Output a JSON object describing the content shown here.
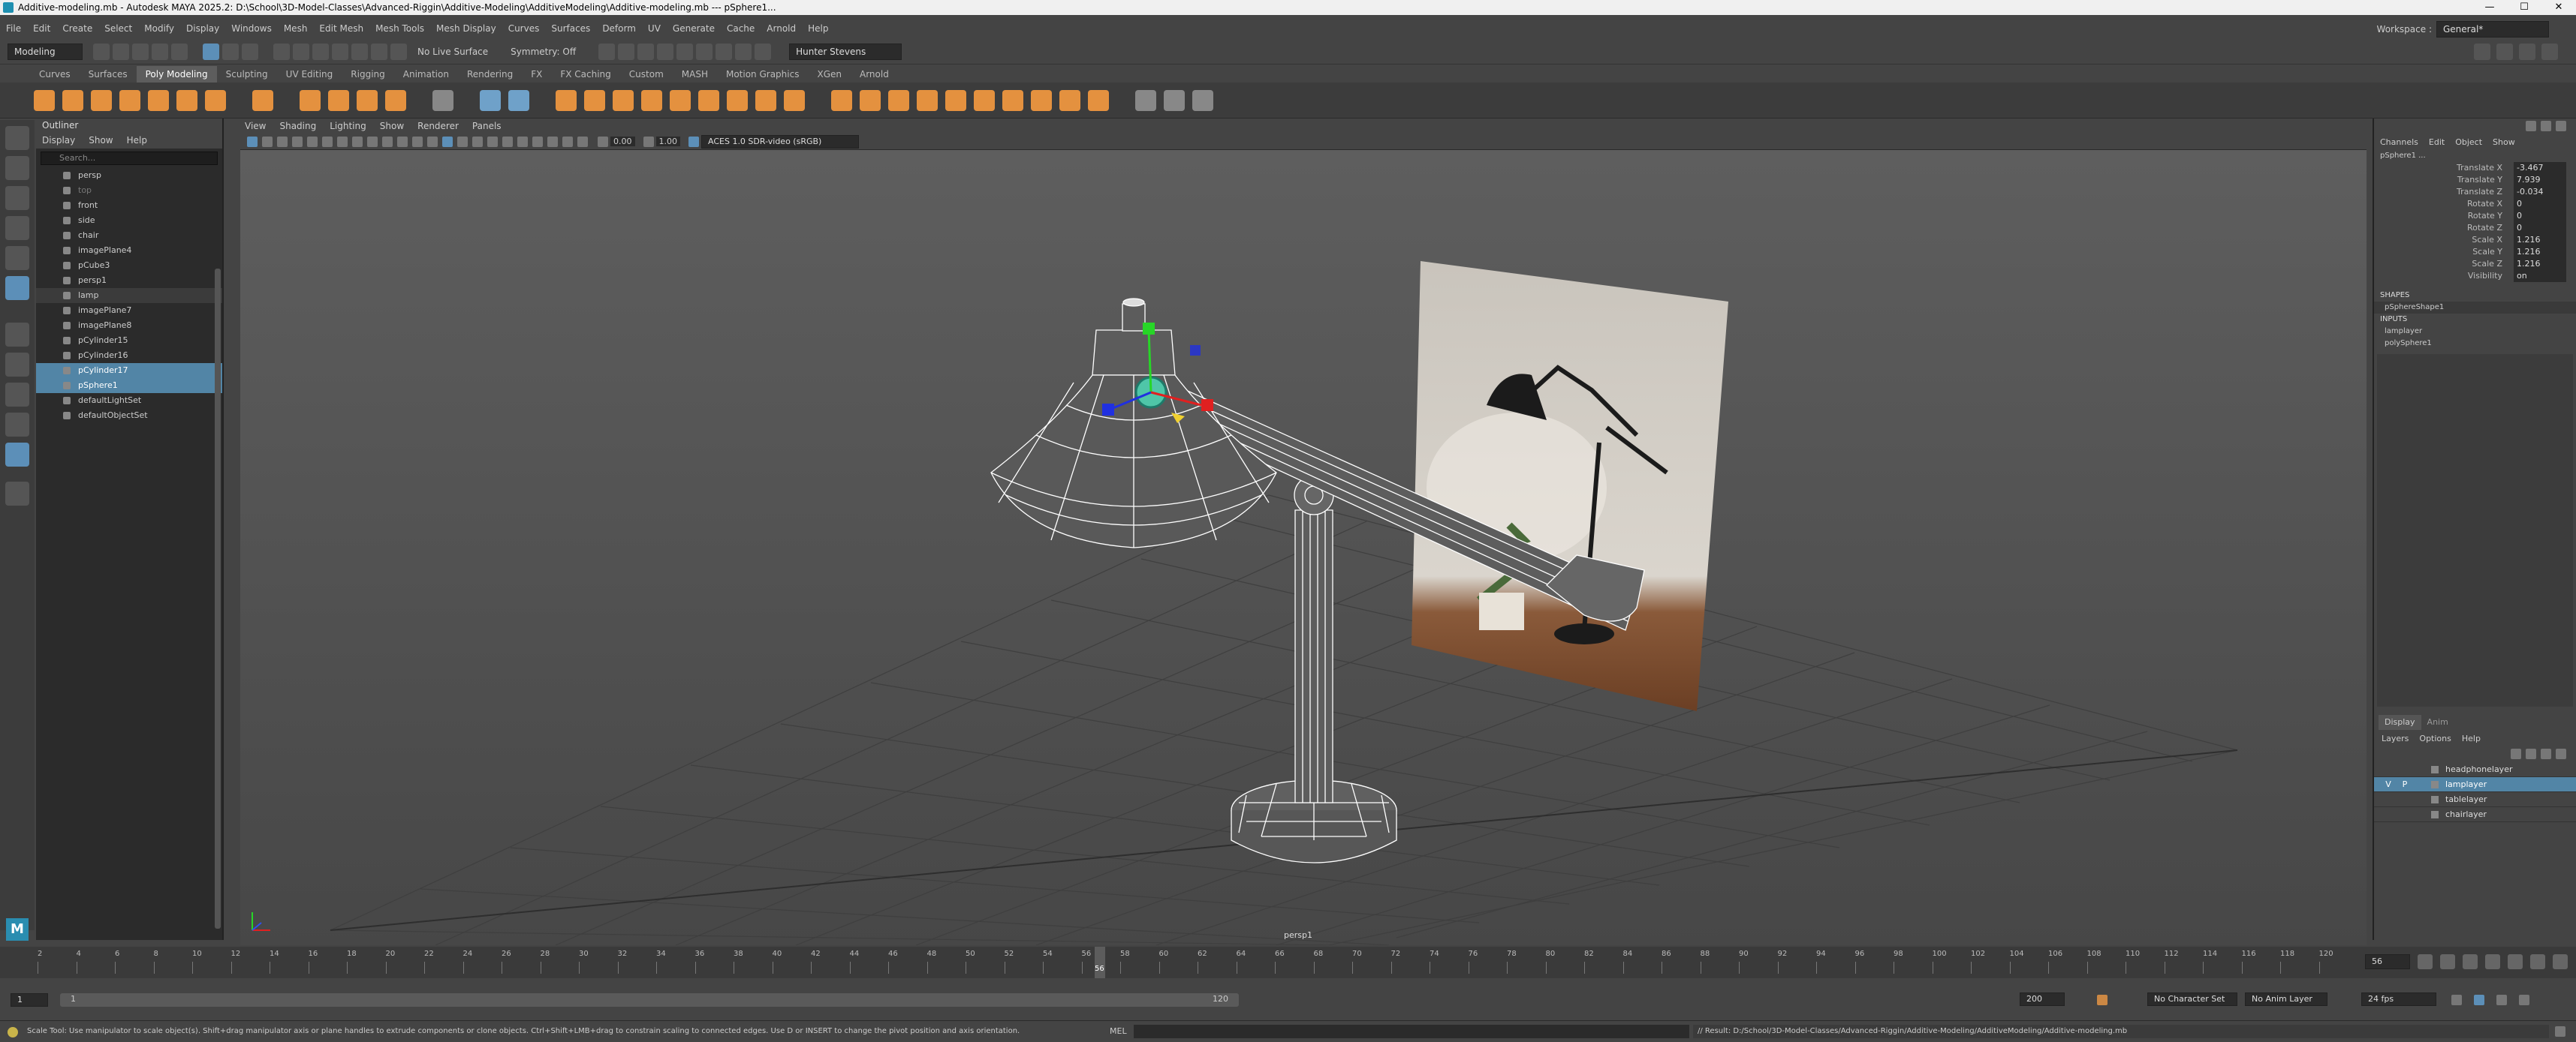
{
  "window": {
    "title": "Additive-modeling.mb - Autodesk MAYA 2025.2: D:\\School\\3D-Model-Classes\\Advanced-Riggin\\Additive-Modeling\\AdditiveModeling\\Additive-modeling.mb  ---  pSphere1...",
    "minimize": "—",
    "maximize": "☐",
    "close": "✕"
  },
  "menubar": {
    "items": [
      "File",
      "Edit",
      "Create",
      "Select",
      "Modify",
      "Display",
      "Windows",
      "Mesh",
      "Edit Mesh",
      "Mesh Tools",
      "Mesh Display",
      "Curves",
      "Surfaces",
      "Deform",
      "UV",
      "Generate",
      "Cache",
      "Arnold",
      "Help"
    ],
    "workspace_label": "Workspace :",
    "workspace_value": "General*"
  },
  "statusline": {
    "mode": "Modeling",
    "live_surface": "No Live Surface",
    "symmetry": "Symmetry: Off",
    "user": "Hunter Stevens"
  },
  "shelf_tabs": [
    "Curves",
    "Surfaces",
    "Poly Modeling",
    "Sculpting",
    "UV Editing",
    "Rigging",
    "Animation",
    "Rendering",
    "FX",
    "FX Caching",
    "Custom",
    "MASH",
    "Motion Graphics",
    "XGen",
    "Arnold"
  ],
  "shelf_active": "Poly Modeling",
  "outliner": {
    "title": "Outliner",
    "menus": [
      "Display",
      "Show",
      "Help"
    ],
    "search_placeholder": "Search...",
    "items": [
      {
        "label": "persp",
        "state": "normal"
      },
      {
        "label": "top",
        "state": "dim"
      },
      {
        "label": "front",
        "state": "normal"
      },
      {
        "label": "side",
        "state": "normal"
      },
      {
        "label": "chair",
        "state": "normal"
      },
      {
        "label": "imagePlane4",
        "state": "normal"
      },
      {
        "label": "pCube3",
        "state": "normal"
      },
      {
        "label": "persp1",
        "state": "normal"
      },
      {
        "label": "lamp",
        "state": "grp"
      },
      {
        "label": "imagePlane7",
        "state": "normal"
      },
      {
        "label": "imagePlane8",
        "state": "normal"
      },
      {
        "label": "pCylinder15",
        "state": "normal"
      },
      {
        "label": "pCylinder16",
        "state": "normal"
      },
      {
        "label": "pCylinder17",
        "state": "sel"
      },
      {
        "label": "pSphere1",
        "state": "sel"
      },
      {
        "label": "defaultLightSet",
        "state": "normal"
      },
      {
        "label": "defaultObjectSet",
        "state": "normal"
      }
    ]
  },
  "viewport": {
    "menus": [
      "View",
      "Shading",
      "Lighting",
      "Show",
      "Renderer",
      "Panels"
    ],
    "exposure": "0.00",
    "gamma": "1.00",
    "color_space": "ACES 1.0 SDR-video (sRGB)",
    "camera_label": "persp1"
  },
  "channel_box": {
    "menus": [
      "Channels",
      "Edit",
      "Object",
      "Show"
    ],
    "object_name": "pSphere1 ...",
    "channels": [
      {
        "name": "Translate X",
        "value": "-3.467"
      },
      {
        "name": "Translate Y",
        "value": "7.939"
      },
      {
        "name": "Translate Z",
        "value": "-0.034"
      },
      {
        "name": "Rotate X",
        "value": "0"
      },
      {
        "name": "Rotate Y",
        "value": "0"
      },
      {
        "name": "Rotate Z",
        "value": "0"
      },
      {
        "name": "Scale X",
        "value": "1.216"
      },
      {
        "name": "Scale Y",
        "value": "1.216"
      },
      {
        "name": "Scale Z",
        "value": "1.216"
      },
      {
        "name": "Visibility",
        "value": "on"
      }
    ],
    "shapes_header": "SHAPES",
    "shape_item": "pSphereShape1",
    "inputs_header": "INPUTS",
    "input_items": [
      "lamplayer",
      "polySphere1"
    ]
  },
  "layer_editor": {
    "tabs": [
      "Display",
      "Anim"
    ],
    "menus": [
      "Layers",
      "Options",
      "Help"
    ],
    "layers": [
      {
        "name": "headphonelayer",
        "selected": false,
        "v": "",
        "p": ""
      },
      {
        "name": "lamplayer",
        "selected": true,
        "v": "V",
        "p": "P"
      },
      {
        "name": "tablelayer",
        "selected": false,
        "v": "",
        "p": ""
      },
      {
        "name": "chairlayer",
        "selected": false,
        "v": "",
        "p": ""
      }
    ]
  },
  "timeline": {
    "ticks": [
      "2",
      "4",
      "6",
      "8",
      "10",
      "12",
      "14",
      "16",
      "18",
      "20",
      "22",
      "24",
      "26",
      "28",
      "30",
      "32",
      "34",
      "36",
      "38",
      "40",
      "42",
      "44",
      "46",
      "48",
      "50",
      "52",
      "54",
      "56",
      "58",
      "60",
      "62",
      "64",
      "66",
      "68",
      "70",
      "72",
      "74",
      "76",
      "78",
      "80",
      "82",
      "84",
      "86",
      "88",
      "90",
      "92",
      "94",
      "96",
      "98",
      "100",
      "102",
      "104",
      "106",
      "108",
      "110",
      "112",
      "114",
      "116",
      "118",
      "120"
    ],
    "current_frame": "56",
    "current_frame_field": "56",
    "range_start": "1",
    "range_start_inner": "1",
    "range_end_inner": "120",
    "range_end": "200",
    "character_set": "No Character Set",
    "anim_layer": "No Anim Layer",
    "fps": "24 fps"
  },
  "helpline": {
    "help_text": "Scale Tool: Use manipulator to scale object(s). Shift+drag manipulator axis or plane handles to extrude components or clone objects. Ctrl+Shift+LMB+drag to constrain scaling to connected edges. Use D or INSERT to change the pivot position and axis orientation.",
    "mel_label": "MEL",
    "result": "// Result: D:/School/3D-Model-Classes/Advanced-Riggin/Additive-Modeling/AdditiveModeling/Additive-modeling.mb"
  },
  "colors": {
    "accent_selection": "#5285a6",
    "shelf_orange": "#e4913f"
  }
}
